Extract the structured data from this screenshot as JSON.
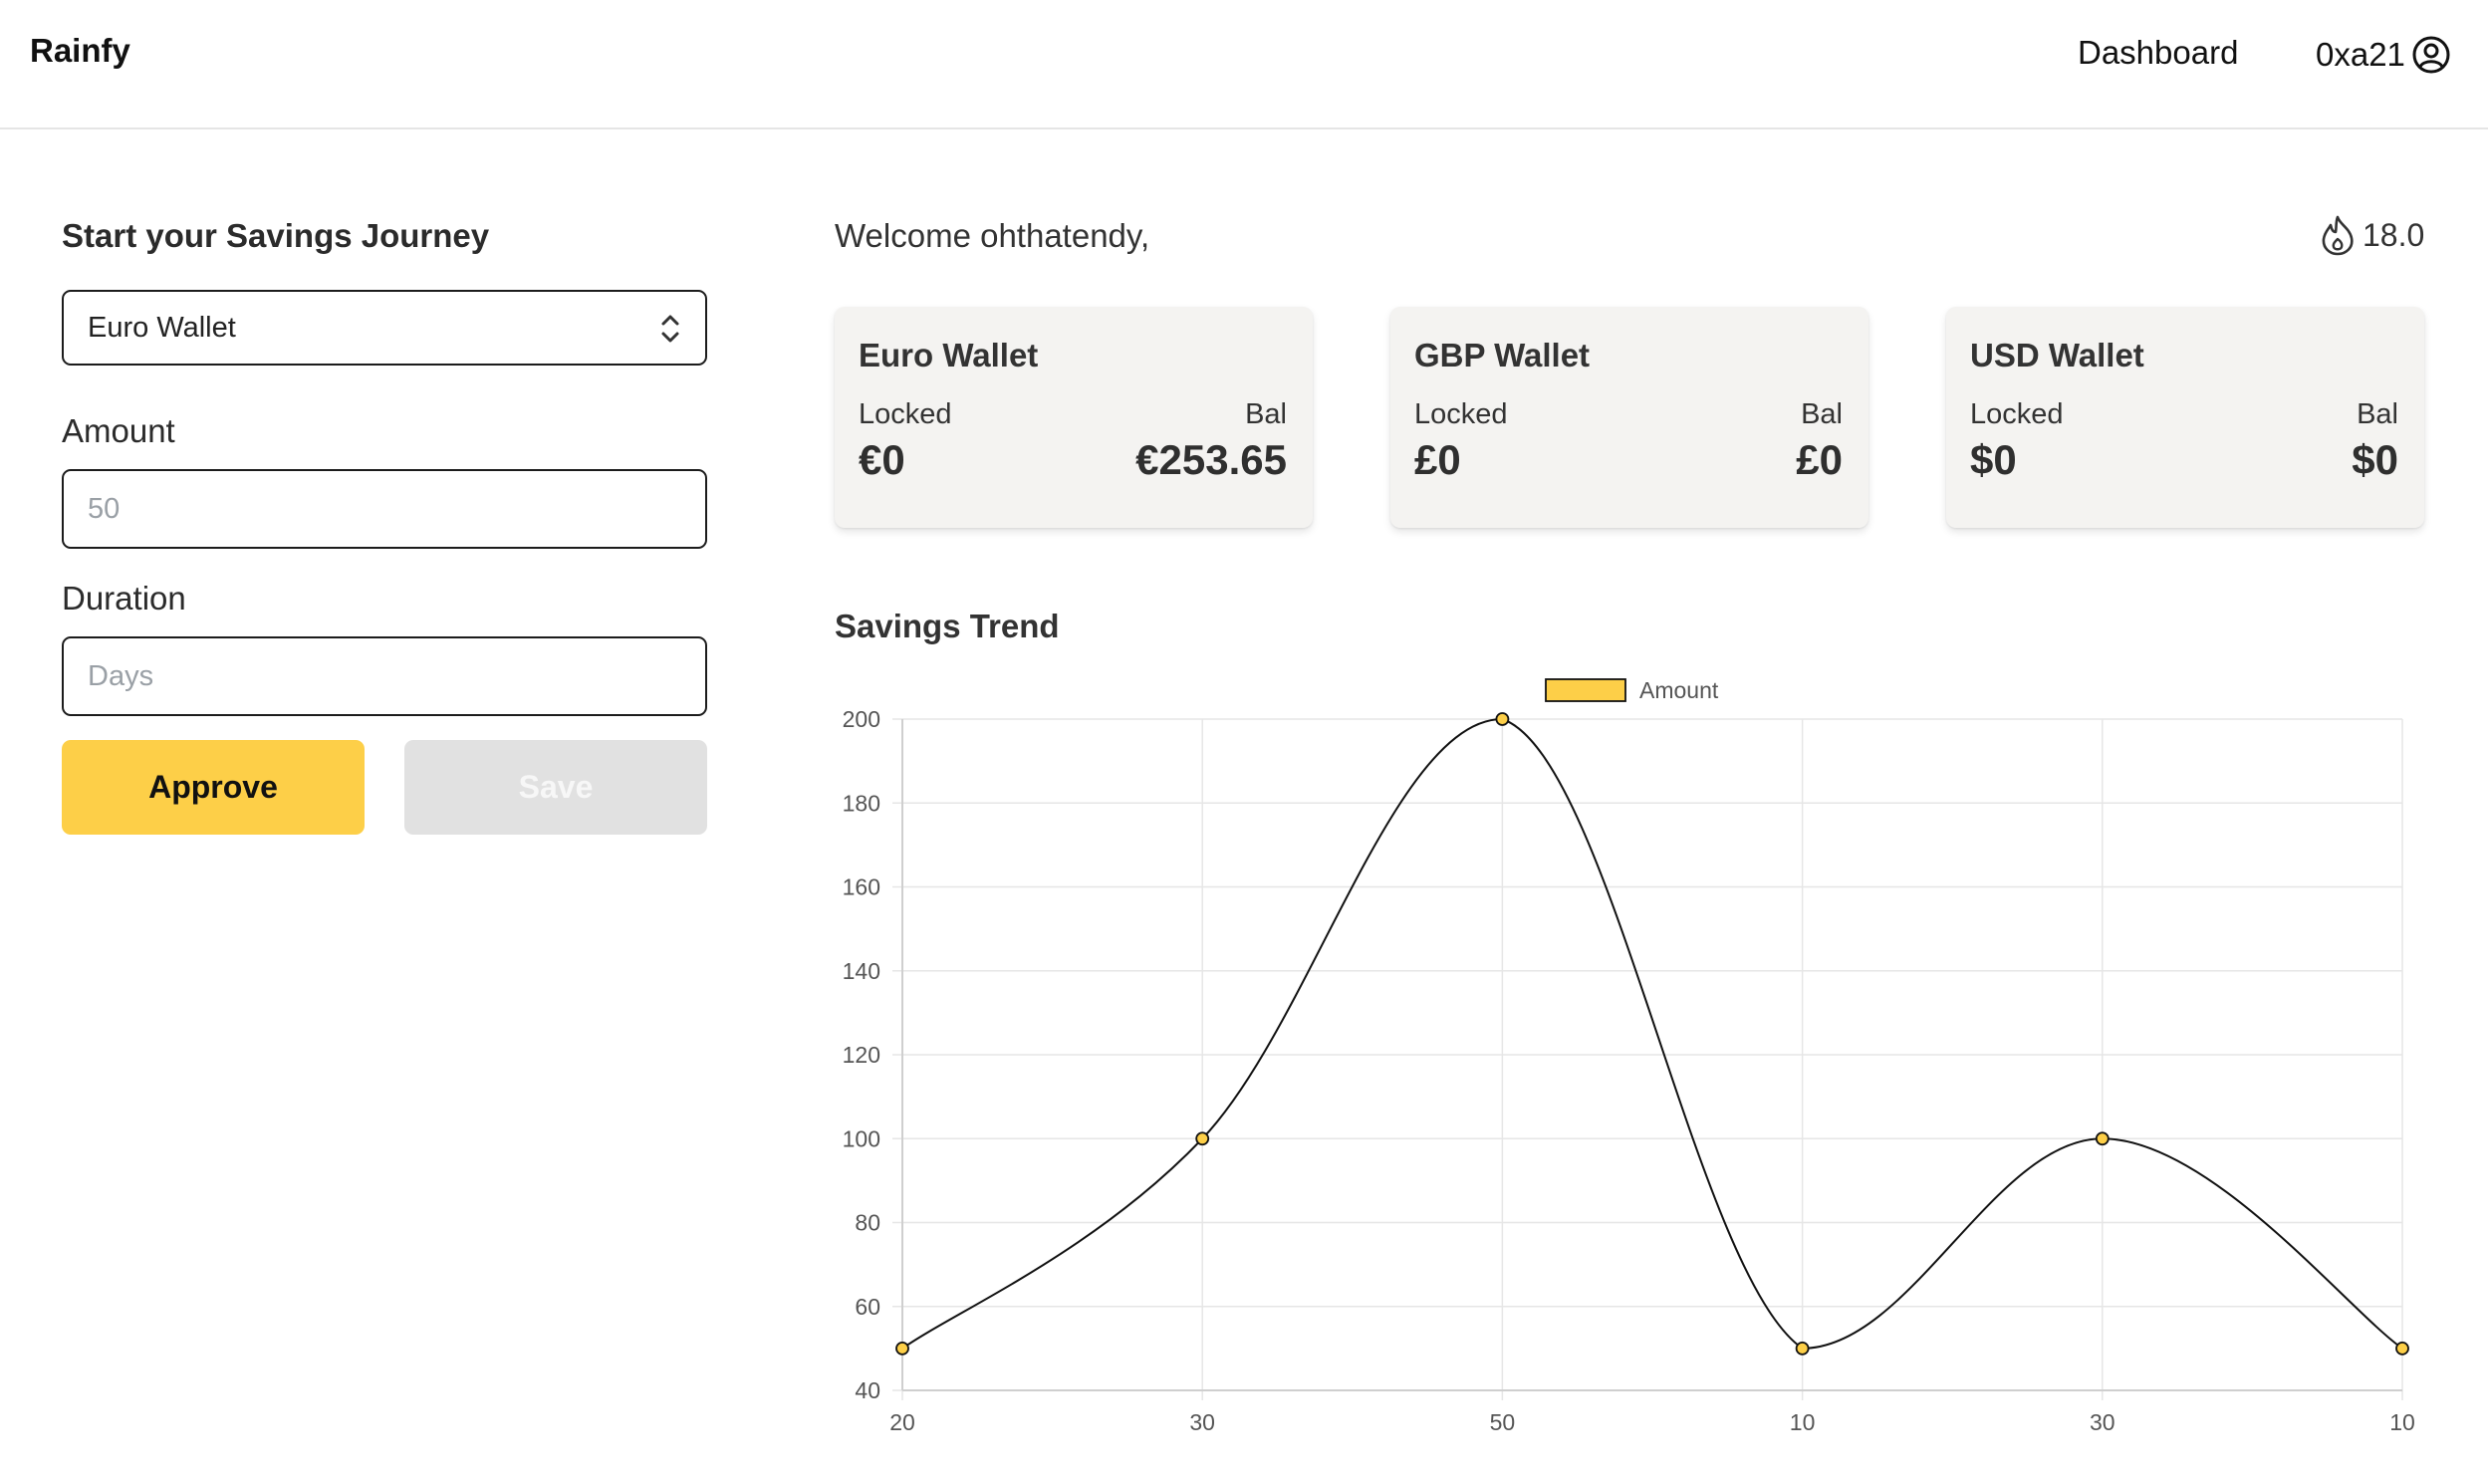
{
  "header": {
    "brand": "Rainfy",
    "nav_dashboard": "Dashboard",
    "account_name": "0xa21",
    "account_icon": "user-circle-icon"
  },
  "form": {
    "title": "Start your Savings Journey",
    "wallet_select": {
      "selected": "Euro Wallet",
      "icon": "chevron-updown-icon"
    },
    "amount": {
      "label": "Amount",
      "placeholder": "50",
      "value": ""
    },
    "duration": {
      "label": "Duration",
      "placeholder": "Days",
      "value": ""
    },
    "approve_label": "Approve",
    "save_label": "Save"
  },
  "main": {
    "welcome": "Welcome ohthatendy,",
    "streak": {
      "icon": "flame-icon",
      "value": "18.0"
    },
    "wallets": [
      {
        "name": "Euro Wallet",
        "locked_label": "Locked",
        "bal_label": "Bal",
        "locked": "€0",
        "bal": "€253.65"
      },
      {
        "name": "GBP Wallet",
        "locked_label": "Locked",
        "bal_label": "Bal",
        "locked": "£0",
        "bal": "£0"
      },
      {
        "name": "USD Wallet",
        "locked_label": "Locked",
        "bal_label": "Bal",
        "locked": "$0",
        "bal": "$0"
      }
    ],
    "trend_title": "Savings Trend"
  },
  "colors": {
    "accent": "#fdcf48",
    "disabled": "#e1e1e1",
    "card_bg": "#f4f3f1",
    "line": "#111111",
    "grid": "#e6e6e6"
  },
  "chart_data": {
    "type": "line",
    "categories": [
      "20",
      "30",
      "50",
      "10",
      "30",
      "10"
    ],
    "series": [
      {
        "name": "Amount",
        "values": [
          50,
          100,
          200,
          50,
          100,
          50
        ],
        "color": "#fdcf48"
      }
    ],
    "yticks": [
      40,
      60,
      80,
      100,
      120,
      140,
      160,
      180,
      200
    ],
    "ylim": [
      40,
      200
    ],
    "grid": true,
    "legend": "top-center",
    "curved": true
  }
}
